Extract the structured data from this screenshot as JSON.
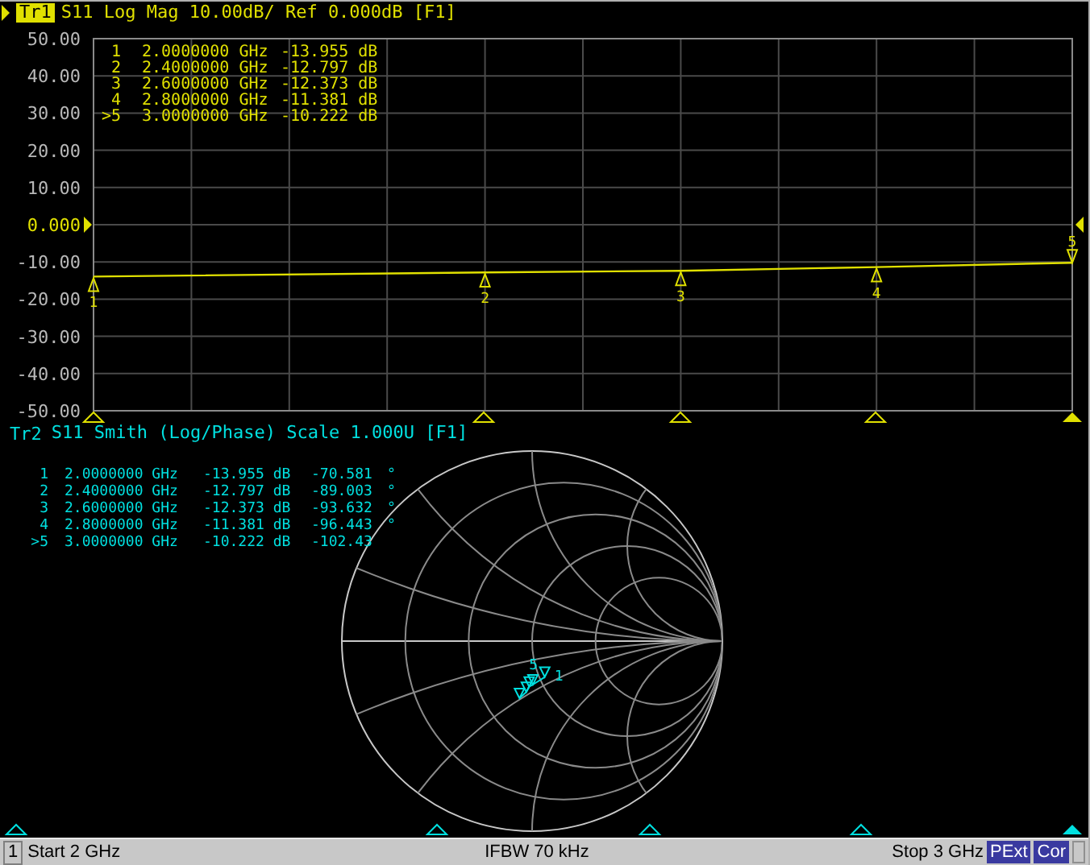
{
  "trace1": {
    "tab": "Tr1",
    "selected": true,
    "header": "S11 Log Mag 10.00dB/ Ref 0.000dB [F1]",
    "marker_table": [
      {
        "number": "1",
        "frequency": "2.0000000 GHz",
        "value": "-13.955 dB"
      },
      {
        "number": "2",
        "frequency": "2.4000000 GHz",
        "value": "-12.797 dB"
      },
      {
        "number": "3",
        "frequency": "2.6000000 GHz",
        "value": "-12.373 dB"
      },
      {
        "number": "4",
        "frequency": "2.8000000 GHz",
        "value": "-11.381 dB"
      },
      {
        "number": ">5",
        "frequency": "3.0000000 GHz",
        "value": "-10.222 dB"
      }
    ],
    "chart_data": {
      "type": "line",
      "grid": true,
      "categories": [
        null,
        null,
        null,
        null,
        null
      ],
      "ylim": [
        -50,
        50
      ],
      "series": [
        {
          "color": "#e0e000",
          "values": [
            -13.955,
            -12.797,
            -12.373,
            -11.381,
            -10.222
          ]
        }
      ],
      "yticks": [
        {
          "value": 50,
          "label": "50.00"
        },
        {
          "value": 40,
          "label": "40.00"
        },
        {
          "value": 30,
          "label": "30.00"
        },
        {
          "value": 20,
          "label": "20.00"
        },
        {
          "value": 10,
          "label": "10.00"
        },
        {
          "value": 0,
          "label": "0.000"
        },
        {
          "value": -10,
          "label": "-10.00"
        },
        {
          "value": -20,
          "label": "-20.00"
        },
        {
          "value": -30,
          "label": "-30.00"
        },
        {
          "value": -40,
          "label": "-40.00"
        },
        {
          "value": -50,
          "label": "-50.00"
        }
      ]
    },
    "trace_markers": [
      {
        "label": "1",
        "active": false
      },
      {
        "label": "2",
        "active": false
      },
      {
        "label": "3",
        "active": false
      },
      {
        "label": "4",
        "active": false
      },
      {
        "label": "5",
        "active": true
      }
    ]
  },
  "trace2": {
    "tab": "Tr2",
    "selected": false,
    "header": "S11 Smith (Log/Phase) Scale 1.000U [F1]",
    "marker_table": [
      {
        "number": "1",
        "frequency": "2.0000000 GHz",
        "magnitude": "-13.955 dB",
        "phase": "-70.581",
        "unit": "°"
      },
      {
        "number": "2",
        "frequency": "2.4000000 GHz",
        "magnitude": "-12.797 dB",
        "phase": "-89.003",
        "unit": "°"
      },
      {
        "number": "3",
        "frequency": "2.6000000 GHz",
        "magnitude": "-12.373 dB",
        "phase": "-93.632",
        "unit": "°"
      },
      {
        "number": "4",
        "frequency": "2.8000000 GHz",
        "magnitude": "-11.381 dB",
        "phase": "-96.443",
        "unit": "°"
      },
      {
        "number": ">5",
        "frequency": "3.0000000 GHz",
        "magnitude": "-10.222 dB",
        "phase": "-102.43"
      }
    ],
    "marker_flags": [
      {
        "label": "5"
      },
      {
        "label": "1"
      }
    ]
  },
  "status_bar": {
    "channel": "1",
    "start": "Start 2 GHz",
    "ifbw": "IFBW 70 kHz",
    "stop": "Stop 3 GHz",
    "badges": [
      "PExt",
      "Cor"
    ]
  }
}
